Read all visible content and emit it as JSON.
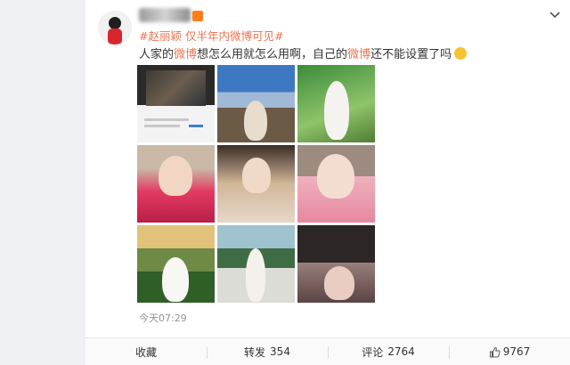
{
  "post": {
    "topics": "#赵丽颖 仅半年内微博可见#",
    "text_before": "人家的",
    "text_hl1": "微博",
    "text_middle": "想怎么用就怎么用啊，自己的",
    "text_hl2": "微博",
    "text_after": "还不能设置了吗",
    "emoji_name": "sweat-smile-emoji",
    "timestamp": "今天07:29"
  },
  "actions": {
    "favorite_label": "收藏",
    "repost_label": "转发",
    "repost_count": "354",
    "comment_label": "评论",
    "comment_count": "2764",
    "like_icon": "thumbs-up-icon",
    "like_count": "9767"
  },
  "colors": {
    "topic": "#eb7350",
    "text": "#333333",
    "meta": "#939393",
    "background": "#eef0f4"
  }
}
